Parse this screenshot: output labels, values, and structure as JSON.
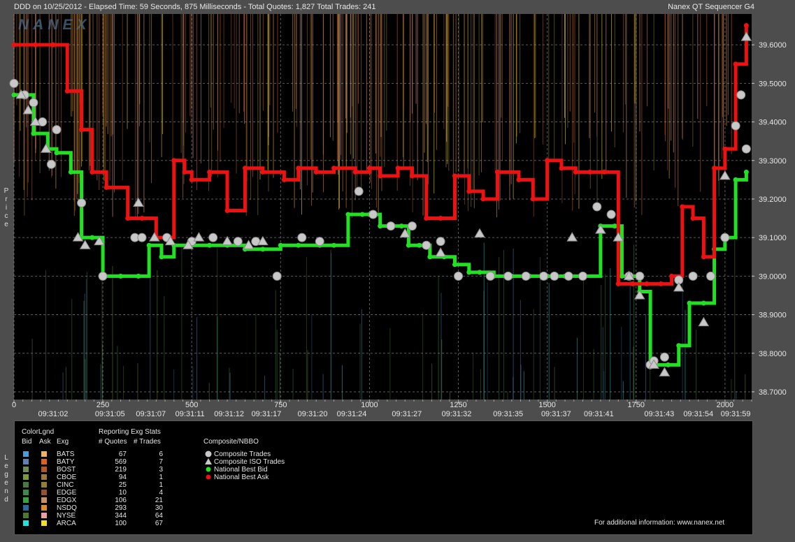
{
  "header": {
    "left": "DDD on 10/25/2012  -  Elapsed Time: 59 Seconds, 875 Milliseconds  -  Total Quotes: 1,827  Total Trades: 241",
    "right": "Nanex QT Sequencer G4"
  },
  "watermark": "NANEX",
  "axis_side_labels": {
    "price": [
      "P",
      "r",
      "i",
      "c",
      "e"
    ],
    "legend": [
      "L",
      "e",
      "g",
      "e",
      "n",
      "d"
    ]
  },
  "chart_data": {
    "type": "line",
    "ylabel": "Price",
    "ylim": [
      38.68,
      39.68
    ],
    "xlim": [
      0,
      2075
    ],
    "y_ticks": [
      "39.6000",
      "39.5000",
      "39.4000",
      "39.3000",
      "39.2000",
      "39.1000",
      "39.0000",
      "38.9000",
      "38.8000",
      "38.7000"
    ],
    "y_tick_values": [
      39.6,
      39.5,
      39.4,
      39.3,
      39.2,
      39.1,
      39.0,
      38.9,
      38.8,
      38.7
    ],
    "x_ticks": [
      0,
      250,
      500,
      750,
      1000,
      1250,
      1500,
      1750,
      2000
    ],
    "x_tick_labels": [
      "0",
      "250",
      "500",
      "750",
      "1000",
      "1250",
      "1500",
      "1750",
      "2000"
    ],
    "time_labels": [
      {
        "x": 110,
        "label": "09:31:02"
      },
      {
        "x": 270,
        "label": "09:31:05"
      },
      {
        "x": 385,
        "label": "09:31:07"
      },
      {
        "x": 495,
        "label": "09:31:11"
      },
      {
        "x": 605,
        "label": "09:31:12"
      },
      {
        "x": 710,
        "label": "09:31:17"
      },
      {
        "x": 840,
        "label": "09:31:20"
      },
      {
        "x": 950,
        "label": "09:31:24"
      },
      {
        "x": 1105,
        "label": "09:31:27"
      },
      {
        "x": 1245,
        "label": "09:31:32"
      },
      {
        "x": 1390,
        "label": "09:31:35"
      },
      {
        "x": 1525,
        "label": "09:31:37"
      },
      {
        "x": 1645,
        "label": "09:31:41"
      },
      {
        "x": 1815,
        "label": "09:31:43"
      },
      {
        "x": 1925,
        "label": "09:31:54"
      },
      {
        "x": 2030,
        "label": "09:31:59"
      }
    ],
    "series": [
      {
        "name": "National Best Bid",
        "x": [
          0,
          55,
          95,
          120,
          160,
          190,
          220,
          250,
          300,
          350,
          380,
          415,
          450,
          500,
          550,
          600,
          650,
          700,
          750,
          800,
          860,
          900,
          940,
          980,
          1000,
          1030,
          1060,
          1090,
          1110,
          1140,
          1170,
          1210,
          1240,
          1280,
          1310,
          1350,
          1400,
          1450,
          1500,
          1550,
          1600,
          1650,
          1690,
          1710,
          1730,
          1760,
          1790,
          1840,
          1870,
          1900,
          1940,
          1970,
          2000,
          2030,
          2060
        ],
        "y": [
          39.47,
          39.37,
          39.33,
          39.32,
          39.27,
          39.1,
          39.1,
          39.0,
          39.0,
          39.0,
          39.08,
          39.05,
          39.08,
          39.08,
          39.08,
          39.08,
          39.07,
          39.07,
          39.08,
          39.08,
          39.08,
          39.08,
          39.16,
          39.16,
          39.16,
          39.13,
          39.13,
          39.13,
          39.08,
          39.08,
          39.05,
          39.05,
          39.03,
          39.01,
          39.01,
          39.0,
          39.0,
          39.0,
          39.0,
          39.0,
          39.0,
          39.13,
          39.13,
          39.0,
          39.0,
          38.96,
          38.77,
          38.77,
          38.82,
          38.93,
          38.93,
          39.07,
          39.1,
          39.25,
          39.27
        ]
      },
      {
        "name": "National Best Ask",
        "x": [
          0,
          60,
          110,
          150,
          190,
          220,
          260,
          320,
          360,
          400,
          450,
          480,
          500,
          550,
          600,
          650,
          700,
          760,
          800,
          850,
          900,
          960,
          1000,
          1030,
          1080,
          1120,
          1160,
          1200,
          1240,
          1280,
          1320,
          1360,
          1420,
          1460,
          1500,
          1540,
          1580,
          1620,
          1660,
          1700,
          1740,
          1780,
          1820,
          1850,
          1880,
          1910,
          1940,
          1970,
          2000,
          2030,
          2060
        ],
        "y": [
          39.6,
          39.6,
          39.6,
          39.48,
          39.38,
          39.27,
          39.23,
          39.15,
          39.15,
          39.1,
          39.3,
          39.27,
          39.25,
          39.27,
          39.17,
          39.28,
          39.27,
          39.25,
          39.28,
          39.27,
          39.28,
          39.27,
          39.28,
          39.26,
          39.28,
          39.26,
          39.15,
          39.15,
          39.26,
          39.22,
          39.2,
          39.27,
          39.25,
          39.2,
          39.3,
          39.28,
          39.27,
          39.27,
          39.27,
          38.98,
          38.98,
          38.98,
          38.98,
          39.0,
          39.18,
          39.15,
          39.05,
          39.28,
          39.33,
          39.55,
          39.65
        ]
      }
    ],
    "trades": {
      "name": "Composite Trades",
      "x": [
        0,
        30,
        55,
        80,
        105,
        120,
        190,
        250,
        340,
        360,
        430,
        500,
        560,
        630,
        680,
        740,
        810,
        860,
        970,
        1010,
        1060,
        1120,
        1160,
        1200,
        1250,
        1340,
        1390,
        1440,
        1490,
        1520,
        1560,
        1600,
        1640,
        1680,
        1730,
        1760,
        1790,
        1800,
        1830,
        1870,
        1910,
        1960,
        2000,
        2030,
        2045,
        2060
      ],
      "y": [
        39.5,
        39.47,
        39.45,
        39.4,
        39.29,
        39.38,
        39.19,
        39.0,
        39.1,
        39.1,
        39.1,
        39.09,
        39.1,
        39.09,
        39.09,
        39.0,
        39.1,
        39.09,
        39.22,
        39.16,
        39.13,
        39.13,
        39.08,
        39.09,
        39.0,
        39.0,
        39.0,
        39.0,
        39.0,
        39.0,
        39.0,
        39.0,
        39.18,
        39.16,
        39.0,
        39.0,
        38.77,
        38.78,
        38.79,
        38.99,
        39.0,
        39.0,
        39.1,
        39.39,
        39.47,
        39.33
      ]
    },
    "iso_trades": {
      "name": "Composite ISO Trades",
      "x": [
        20,
        40,
        60,
        90,
        180,
        200,
        240,
        350,
        395,
        440,
        490,
        520,
        600,
        660,
        700,
        1100,
        1200,
        1310,
        1570,
        1650,
        1700,
        1730,
        1760,
        1800,
        1830,
        1870,
        1940,
        2000,
        2060
      ],
      "y": [
        39.47,
        39.43,
        39.4,
        39.33,
        39.1,
        39.08,
        39.09,
        39.19,
        39.1,
        39.09,
        39.08,
        39.1,
        39.09,
        39.08,
        39.09,
        39.11,
        39.06,
        39.11,
        39.1,
        39.12,
        39.1,
        39.0,
        38.95,
        38.77,
        38.75,
        38.97,
        38.88,
        39.26,
        39.62
      ]
    }
  },
  "legend": {
    "title_colorlgnd": "ColorLgnd",
    "title_stats": "Reporting Exg Stats",
    "col_bid": "Bid",
    "col_ask": "Ask",
    "col_exg": "Exg",
    "col_quotes": "# Quotes",
    "col_trades": "# Trades",
    "composite_title": "Composite/NBBO",
    "rows": [
      {
        "exg": "BATS",
        "quotes": "67",
        "trades": "6",
        "bid_color": "#4f9bd8",
        "ask_color": "#f0b060"
      },
      {
        "exg": "BATY",
        "quotes": "569",
        "trades": "7",
        "bid_color": "#5a82b5",
        "ask_color": "#e06020"
      },
      {
        "exg": "BOST",
        "quotes": "219",
        "trades": "3",
        "bid_color": "#6e8a5a",
        "ask_color": "#b05828"
      },
      {
        "exg": "CBOE",
        "quotes": "94",
        "trades": "1",
        "bid_color": "#7a9a3a",
        "ask_color": "#a0783a"
      },
      {
        "exg": "CINC",
        "quotes": "25",
        "trades": "1",
        "bid_color": "#4a7a3a",
        "ask_color": "#908030"
      },
      {
        "exg": "EDGE",
        "quotes": "10",
        "trades": "4",
        "bid_color": "#3a8a4a",
        "ask_color": "#9a5030"
      },
      {
        "exg": "EDGX",
        "quotes": "106",
        "trades": "21",
        "bid_color": "#3aa040",
        "ask_color": "#c89060"
      },
      {
        "exg": "NSDQ",
        "quotes": "293",
        "trades": "30",
        "bid_color": "#2a6aa0",
        "ask_color": "#e08a20"
      },
      {
        "exg": "NYSE",
        "quotes": "344",
        "trades": "64",
        "bid_color": "#4a7a2a",
        "ask_color": "#f0a0a0"
      },
      {
        "exg": "ARCA",
        "quotes": "100",
        "trades": "67",
        "bid_color": "#20e0e0",
        "ask_color": "#f0e020"
      }
    ],
    "composite_items": [
      {
        "label": "Composite Trades",
        "marker": "circle",
        "color": "#c8c8c8"
      },
      {
        "label": "Composite ISO Trades",
        "marker": "triangle",
        "color": "#c8c8c8"
      },
      {
        "label": "National Best Bid",
        "marker": "dot",
        "color": "#22e022"
      },
      {
        "label": "National Best Ask",
        "marker": "dot",
        "color": "#ee1111"
      }
    ],
    "footer": "For additional information: www.nanex.net"
  }
}
